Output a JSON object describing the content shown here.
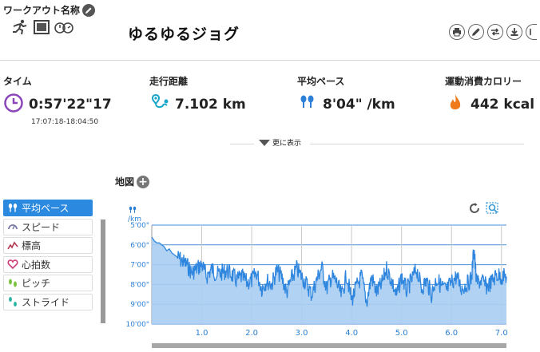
{
  "header": {
    "workout_label": "ワークアウト名称",
    "title": "ゆるゆるジョグ"
  },
  "stats": {
    "time": {
      "label": "タイム",
      "value": "0:57'22\"17",
      "range": "17:07:18-18:04:50"
    },
    "distance": {
      "label": "走行距離",
      "value": "7.102 km"
    },
    "pace": {
      "label": "平均ペース",
      "value": "8'04\" /km"
    },
    "calories": {
      "label": "運動消費カロリー",
      "value": "442 kcal"
    }
  },
  "more_label": "更に表示",
  "map_label": "地図",
  "menu": {
    "items": [
      {
        "label": "平均ペース",
        "icon": "pace-icon",
        "active": true
      },
      {
        "label": "スピード",
        "icon": "speedometer-icon",
        "active": false
      },
      {
        "label": "標高",
        "icon": "elevation-icon",
        "active": false
      },
      {
        "label": "心拍数",
        "icon": "heart-icon",
        "active": false
      },
      {
        "label": "ピッチ",
        "icon": "pitch-icon",
        "active": false
      },
      {
        "label": "ストライド",
        "icon": "stride-icon",
        "active": false
      }
    ]
  },
  "colors": {
    "accent": "#2b8ae0",
    "fill": "#a9cdf2",
    "line": "#2f86de",
    "grid": "#4a90d9"
  },
  "chart_data": {
    "type": "area",
    "unit_label": "/km",
    "ylabel": "",
    "xlabel": "",
    "y_ticks": [
      "5'00\"",
      "6'00\"",
      "7'00\"",
      "8'00\"",
      "9'00\"",
      "10'00\""
    ],
    "x_ticks": [
      "1.0",
      "2.0",
      "3.0",
      "4.0",
      "5.0",
      "6.0",
      "7.0"
    ],
    "xlim": [
      0,
      7.1
    ],
    "ylim_min_per_km": [
      5,
      10
    ],
    "y_inverted": true,
    "series": [
      {
        "x": [
          0.0,
          0.05,
          0.1,
          0.15,
          0.2,
          0.25,
          0.3,
          0.35,
          0.4,
          0.45,
          0.5,
          0.6,
          0.7,
          0.8,
          0.9,
          1.0,
          1.1,
          1.2,
          1.3,
          1.4,
          1.5,
          1.6,
          1.7,
          1.8,
          1.9,
          2.0,
          2.1,
          2.2,
          2.3,
          2.4,
          2.5,
          2.6,
          2.7,
          2.8,
          2.9,
          3.0,
          3.1,
          3.2,
          3.3,
          3.4,
          3.5,
          3.6,
          3.7,
          3.8,
          3.9,
          4.0,
          4.1,
          4.2,
          4.3,
          4.4,
          4.5,
          4.6,
          4.7,
          4.8,
          4.9,
          5.0,
          5.1,
          5.2,
          5.3,
          5.4,
          5.5,
          5.6,
          5.7,
          5.8,
          5.9,
          6.0,
          6.1,
          6.2,
          6.3,
          6.4,
          6.45,
          6.5,
          6.6,
          6.7,
          6.8,
          6.9,
          7.0,
          7.1
        ],
        "y": [
          5.6,
          5.8,
          5.9,
          5.9,
          6.0,
          6.1,
          6.3,
          6.2,
          6.4,
          6.5,
          6.6,
          6.8,
          7.0,
          7.4,
          7.2,
          7.0,
          7.6,
          7.2,
          7.5,
          7.4,
          7.3,
          7.5,
          7.8,
          7.6,
          7.9,
          7.8,
          7.4,
          8.2,
          7.8,
          8.0,
          7.3,
          7.6,
          8.4,
          7.7,
          7.2,
          7.6,
          8.0,
          8.5,
          7.8,
          7.1,
          8.2,
          7.6,
          7.9,
          8.6,
          7.5,
          8.8,
          8.1,
          7.6,
          8.9,
          7.6,
          8.4,
          8.0,
          7.2,
          7.8,
          8.6,
          7.6,
          8.3,
          7.8,
          7.2,
          8.2,
          7.8,
          8.5,
          7.7,
          8.1,
          8.3,
          7.9,
          7.6,
          8.2,
          8.0,
          7.7,
          6.1,
          7.9,
          7.8,
          8.1,
          7.9,
          7.5,
          7.6,
          7.6
        ]
      }
    ]
  }
}
